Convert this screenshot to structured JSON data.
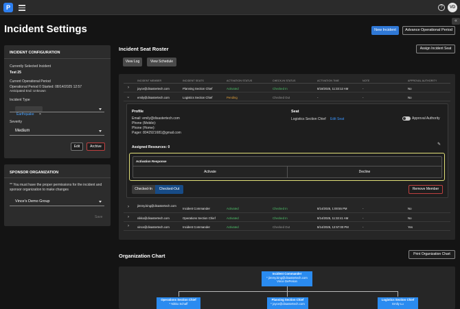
{
  "topbar": {
    "logo_text": "P",
    "avatar_initials": "VD",
    "help_glyph": "?",
    "collapse_glyph": "«"
  },
  "page": {
    "title": "Incident Settings"
  },
  "header_buttons": {
    "new_incident": "New Incident",
    "advance_op": "Advance Operational Period"
  },
  "incident_config": {
    "heading": "INCIDENT CONFIGURATION",
    "selected_label": "Currently Selected Incident",
    "selected_value": "Test 25",
    "op_period_label": "Current Operational Period",
    "op_period_value": "Operational Period 0 Started: 08/14/2025 12:57",
    "anticipated_end": "Anticipated End: Unknown",
    "incident_type_label": "Incident Type",
    "incident_type_chip": "Earthquake",
    "chip_remove": "×",
    "severity_label": "Severity",
    "severity_value": "Medium",
    "edit_button": "Edit",
    "archive_button": "Archive"
  },
  "sponsor": {
    "heading": "SPONSOR ORGANIZATION",
    "notice": "** You must have the proper permissions for the incident and sponsor organization to make changes",
    "org_value": "Vince's Demo Group",
    "save_button": "Save"
  },
  "roster": {
    "title": "Incident Seat Roster",
    "assign_button": "Assign Incident Seat",
    "view_log": "View Log",
    "view_schedule": "View Schedule",
    "columns": [
      "INCIDENT MEMBER",
      "INCIDENT SEATS",
      "ACTIVATION STATUS",
      "CHECK-IN STATUS",
      "ACTIVATION TIME",
      "NOTE",
      "APPROVAL AUTHORITY"
    ],
    "rows_top": [
      {
        "member": "joyce@disastertech.com",
        "seat": "Planning Section Chief",
        "activation": "Activated",
        "checkin": "Checked In",
        "time": "8/18/2025, 11:33:12 AM",
        "note": "-",
        "approval": "No"
      },
      {
        "member": "emily@disastertech.com",
        "seat": "Logistics Section Chief",
        "activation": "Pending",
        "checkin": "Checked Out",
        "time": "-",
        "note": "-",
        "approval": "No"
      }
    ],
    "rows_bottom": [
      {
        "member": "jimmy.king@disastertech.com",
        "seat": "Incident Commander",
        "activation": "Activated",
        "checkin": "Checked In",
        "time": "8/14/2025, 1:00:55 PM",
        "note": "-",
        "approval": "No"
      },
      {
        "member": "nikko@disastertech.com",
        "seat": "Operations Section Chief",
        "activation": "Activated",
        "checkin": "Checked In",
        "time": "8/14/2025, 11:32:41 AM",
        "note": "-",
        "approval": "No"
      },
      {
        "member": "vince@disastertech.com",
        "seat": "Incident Commander",
        "activation": "Activated",
        "checkin": "Checked Out",
        "time": "8/14/2025, 12:57:00 PM",
        "note": "-",
        "approval": "Yes"
      }
    ],
    "detail": {
      "profile_heading": "Profile",
      "email": "Email: emily@disastertech.com",
      "phone_mobile": "Phone (Mobile):",
      "phone_home": "Phone (Home):",
      "pager": "Pager: 8042921681@gmail.com",
      "seat_heading": "Seat",
      "seat_value": "Logistics Section Chief",
      "edit_seat": "Edit Seat",
      "approval_authority": "Approval Authority",
      "assigned_resources": "Assigned Resources: 0",
      "activation_response": "Activation Response",
      "activate": "Activate",
      "decline": "Decline",
      "checked_in": "Checked-In",
      "checked_out": "Checked-Out",
      "remove_member": "Remove Member"
    }
  },
  "org_chart": {
    "title": "Organization Chart",
    "print_button": "Print Organization Chart",
    "top_node": {
      "title": "Incident Commander",
      "lines": [
        "* jimmy.king@disastertech.com",
        "Vince DePerion"
      ]
    },
    "children": [
      {
        "title": "Operations Section Chief",
        "line": "* Nikko Schaff"
      },
      {
        "title": "Planning Section Chief",
        "line": "* joyce@disastertech.com"
      },
      {
        "title": "Logistics Section Chief",
        "line": "Emily Lu"
      }
    ]
  },
  "colors": {
    "accent": "#2f78d6",
    "activated": "#4fc36b",
    "pending": "#e5a23a",
    "highlight": "#e4e27a",
    "danger": "#c04040"
  }
}
